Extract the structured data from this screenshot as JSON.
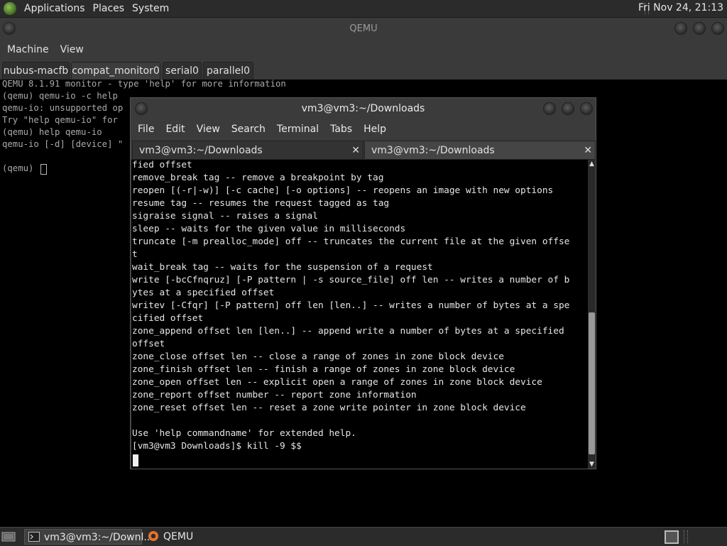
{
  "top_panel": {
    "menus": [
      "Applications",
      "Places",
      "System"
    ],
    "clock": "Fri Nov 24, 21:13"
  },
  "qemu_window": {
    "title": "QEMU",
    "menu": [
      "Machine",
      "View"
    ],
    "tabs": [
      "nubus-macfb",
      "compat_monitor0",
      "serial0",
      "parallel0"
    ],
    "active_tab": "compat_monitor0",
    "monitor_lines": [
      "QEMU 8.1.91 monitor - type 'help' for more information",
      "(qemu) qemu-io -c help",
      "qemu-io: unsupported op",
      "Try \"help qemu-io\" for",
      "(qemu) help qemu-io",
      "qemu-io [-d] [device] \"",
      "",
      "(qemu) "
    ]
  },
  "terminal_window": {
    "title": "vm3@vm3:~/Downloads",
    "menu": [
      "File",
      "Edit",
      "View",
      "Search",
      "Terminal",
      "Tabs",
      "Help"
    ],
    "tabs": [
      "vm3@vm3:~/Downloads",
      "vm3@vm3:~/Downloads"
    ],
    "active_tab_index": 1,
    "lines": [
      "fied offset",
      "remove_break tag -- remove a breakpoint by tag",
      "reopen [(-r|-w)] [-c cache] [-o options] -- reopens an image with new options",
      "resume tag -- resumes the request tagged as tag",
      "sigraise signal -- raises a signal",
      "sleep -- waits for the given value in milliseconds",
      "truncate [-m prealloc_mode] off -- truncates the current file at the given offse",
      "t",
      "wait_break tag -- waits for the suspension of a request",
      "write [-bcCfnqruz] [-P pattern | -s source_file] off len -- writes a number of b",
      "ytes at a specified offset",
      "writev [-Cfqr] [-P pattern] off len [len..] -- writes a number of bytes at a spe",
      "cified offset",
      "zone_append offset len [len..] -- append write a number of bytes at a specified",
      "offset",
      "zone_close offset len -- close a range of zones in zone block device",
      "zone_finish offset len -- finish a range of zones in zone block device",
      "zone_open offset len -- explicit open a range of zones in zone block device",
      "zone_report offset number -- report zone information",
      "zone_reset offset len -- reset a zone write pointer in zone block device",
      "",
      "Use 'help commandname' for extended help.",
      "[vm3@vm3 Downloads]$ kill -9 $$"
    ]
  },
  "taskbar": {
    "items": [
      {
        "label": "vm3@vm3:~/Downl...",
        "icon": "terminal-icon"
      },
      {
        "label": "QEMU",
        "icon": "qemu-icon"
      }
    ]
  }
}
